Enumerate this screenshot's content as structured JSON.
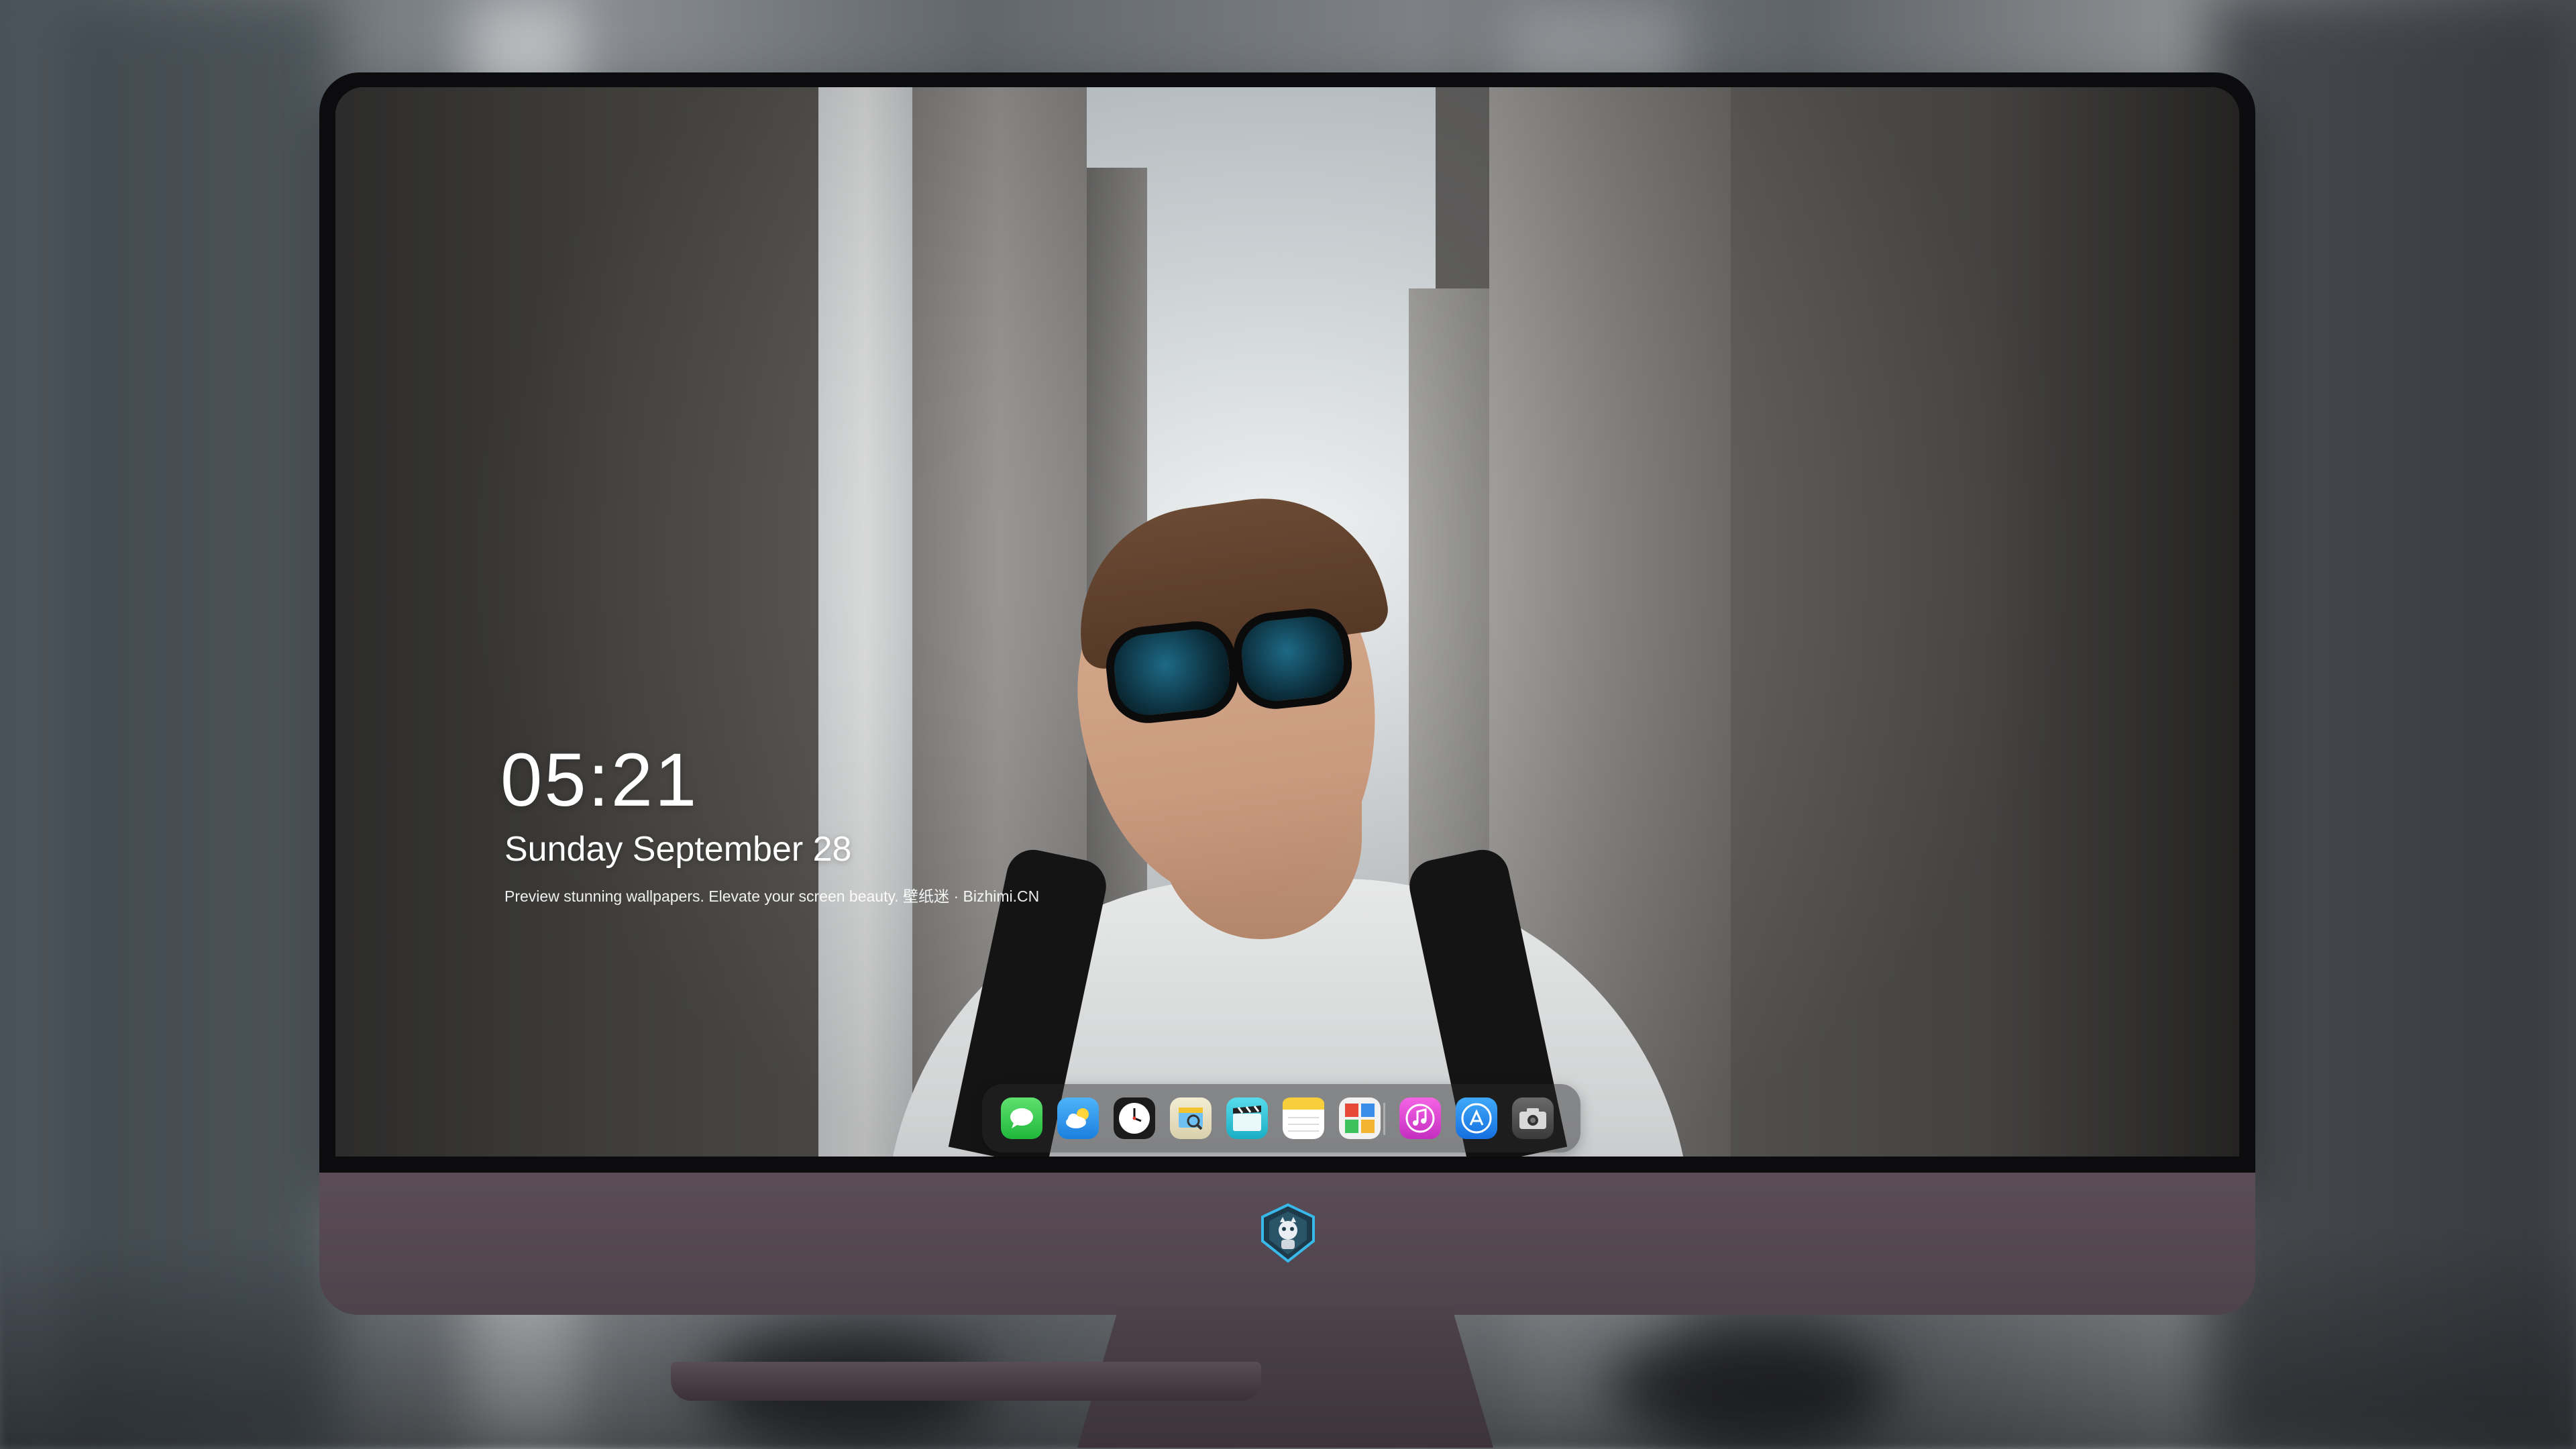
{
  "lock_screen": {
    "time": "05:21",
    "date": "Sunday September 28",
    "caption": "Preview stunning wallpapers. Elevate your screen beauty. 壁纸迷 · Bizhimi.CN"
  },
  "dock": {
    "apps": [
      {
        "name": "Messages",
        "icon": "message-bubble-icon",
        "color": "#2fcc49"
      },
      {
        "name": "Weather",
        "icon": "cloud-sun-icon",
        "color": "#2f9bf0"
      },
      {
        "name": "Clock",
        "icon": "clock-icon",
        "color": "#1b1b1b"
      },
      {
        "name": "Preview",
        "icon": "preview-icon",
        "color": "#e9e3c8"
      },
      {
        "name": "Final Cut Pro",
        "icon": "clapperboard-icon",
        "color": "#2cc6d8"
      },
      {
        "name": "Notes",
        "icon": "notes-icon",
        "color": "#f8d54a"
      },
      {
        "name": "Photo Booth",
        "icon": "photo-grid-icon",
        "color": "#e8e8e8"
      },
      {
        "name": "iTunes",
        "icon": "music-note-icon",
        "color": "#e33fd2"
      },
      {
        "name": "App Store",
        "icon": "app-store-icon",
        "color": "#1e86f0"
      },
      {
        "name": "Camera",
        "icon": "camera-icon",
        "color": "#4a4a4a"
      }
    ]
  },
  "colors": {
    "chin": "#52454f",
    "bezel": "#0c0c0e",
    "logo_accent": "#39b9ea"
  }
}
